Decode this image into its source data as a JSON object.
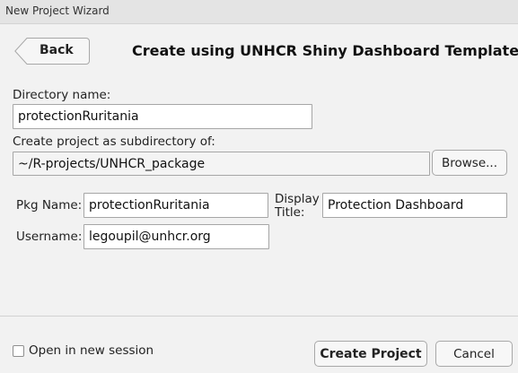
{
  "window": {
    "title": "New Project Wizard"
  },
  "header": {
    "back_label": "Back",
    "title": "Create using UNHCR Shiny Dashboard Template"
  },
  "form": {
    "directory_name_label": "Directory name:",
    "directory_name_value": "protectionRuritania",
    "subdir_label": "Create project as subdirectory of:",
    "subdir_value": "~/R-projects/UNHCR_package",
    "browse_label": "Browse...",
    "pkg_name_label": "Pkg Name:",
    "pkg_name_value": "protectionRuritania",
    "display_title_label_line1": "Display",
    "display_title_label_line2": "Title:",
    "display_title_value": "Protection Dashboard",
    "username_label": "Username:",
    "username_value": "legoupil@unhcr.org"
  },
  "footer": {
    "open_new_session_label": "Open in new session",
    "open_new_session_checked": false,
    "create_label": "Create Project",
    "cancel_label": "Cancel"
  }
}
